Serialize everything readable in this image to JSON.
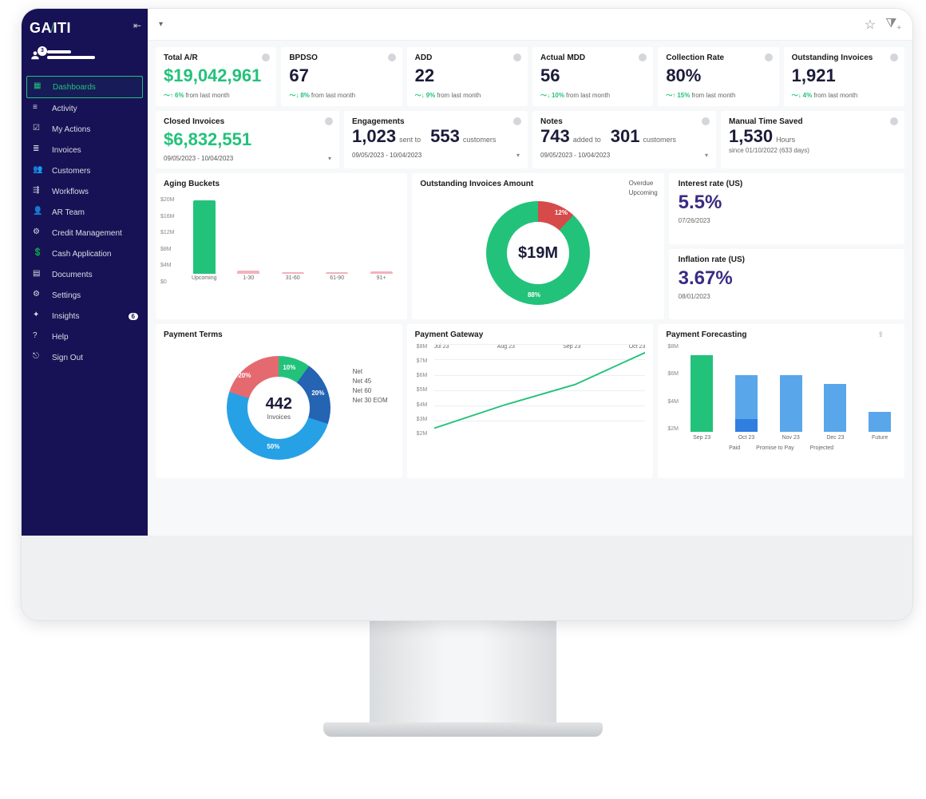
{
  "app": {
    "logo_left": "GA",
    "logo_right": "ITI"
  },
  "user": {
    "badge": "3"
  },
  "sidebar": {
    "items": [
      {
        "label": "Dashboards",
        "active": true
      },
      {
        "label": "Activity"
      },
      {
        "label": "My Actions"
      },
      {
        "label": "Invoices"
      },
      {
        "label": "Customers"
      },
      {
        "label": "Workflows"
      },
      {
        "label": "AR Team"
      },
      {
        "label": "Credit Management"
      },
      {
        "label": "Cash Application"
      },
      {
        "label": "Documents"
      },
      {
        "label": "Settings"
      },
      {
        "label": "Insights",
        "badge": "6"
      },
      {
        "label": "Help"
      },
      {
        "label": "Sign Out"
      }
    ]
  },
  "kpis": [
    {
      "title": "Total A/R",
      "value": "$19,042,961",
      "color": "green",
      "trend": "up",
      "delta": "6%",
      "sub": "from last month"
    },
    {
      "title": "BPDSO",
      "value": "67",
      "color": "dark",
      "trend": "downgreen",
      "delta": "8%",
      "sub": "from last month"
    },
    {
      "title": "ADD",
      "value": "22",
      "color": "dark",
      "trend": "downgreen",
      "delta": "9%",
      "sub": "from last month"
    },
    {
      "title": "Actual MDD",
      "value": "56",
      "color": "dark",
      "trend": "downgreen",
      "delta": "10%",
      "sub": "from last month"
    },
    {
      "title": "Collection Rate",
      "value": "80%",
      "color": "dark",
      "trend": "up",
      "delta": "15%",
      "sub": "from last month"
    },
    {
      "title": "Outstanding Invoices",
      "value": "1,921",
      "color": "dark",
      "trend": "downgreen",
      "delta": "4%",
      "sub": "from last month"
    }
  ],
  "row2": {
    "closed": {
      "title": "Closed Invoices",
      "value": "$6,832,551",
      "date": "09/05/2023 - 10/04/2023"
    },
    "engagements": {
      "title": "Engagements",
      "v1": "1,023",
      "l1": "sent to",
      "v2": "553",
      "l2": "customers",
      "date": "09/05/2023 - 10/04/2023"
    },
    "notes": {
      "title": "Notes",
      "v1": "743",
      "l1": "added to",
      "v2": "301",
      "l2": "customers",
      "date": "09/05/2023 - 10/04/2023"
    },
    "timesaved": {
      "title": "Manual Time Saved",
      "value": "1,530",
      "unit": "Hours",
      "sub": "since 01/10/2022 (633 days)"
    }
  },
  "aging": {
    "title": "Aging Buckets",
    "yticks": [
      "$20M",
      "$16M",
      "$12M",
      "$8M",
      "$4M",
      "$0"
    ],
    "bars": [
      {
        "label": "Upcoming",
        "value": 16.8,
        "color": "#22c27a"
      },
      {
        "label": "1-30",
        "value": 0.7,
        "color": "#f1b2bc"
      },
      {
        "label": "31-60",
        "value": 0.4,
        "color": "#f1b2bc"
      },
      {
        "label": "61-90",
        "value": 0.4,
        "color": "#f1b2bc"
      },
      {
        "label": "91+",
        "value": 0.6,
        "color": "#f1b2bc"
      }
    ]
  },
  "outstanding_donut": {
    "title": "Outstanding Invoices Amount",
    "center": "$19M",
    "slices": [
      {
        "label": "12%",
        "name": "Overdue"
      },
      {
        "label": "88%",
        "name": "Upcoming"
      }
    ],
    "legend": [
      "Overdue",
      "Upcoming"
    ]
  },
  "rates": {
    "interest": {
      "title": "Interest rate (US)",
      "value": "5.5%",
      "date": "07/26/2023"
    },
    "inflation": {
      "title": "Inflation rate (US)",
      "value": "3.67%",
      "date": "08/01/2023"
    }
  },
  "payment_terms": {
    "title": "Payment Terms",
    "center": "442",
    "center_sub": "Invoices",
    "slices": [
      {
        "pct": "10%",
        "name": "Net"
      },
      {
        "pct": "20%",
        "name": "Net 45"
      },
      {
        "pct": "50%",
        "name": "Net 60"
      },
      {
        "pct": "20%",
        "name": "Net 30 EOM"
      }
    ]
  },
  "gateway": {
    "title": "Payment Gateway",
    "yticks": [
      "$8M",
      "$7M",
      "$6M",
      "$5M",
      "$4M",
      "$3M",
      "$2M"
    ],
    "x": [
      "Jul 23",
      "Aug 23",
      "Sep 23",
      "Oct 23"
    ],
    "values": [
      2.4,
      4.0,
      5.4,
      7.6
    ]
  },
  "forecast": {
    "title": "Payment Forecasting",
    "yticks": [
      "$8M",
      "$6M",
      "$4M",
      "$2M"
    ],
    "cols": [
      {
        "x": "Sep 23",
        "paid": 7.0,
        "promise": 0,
        "proj": 0
      },
      {
        "x": "Oct 23",
        "paid": 0,
        "promise": 1.2,
        "proj": 4.0
      },
      {
        "x": "Nov 23",
        "paid": 0,
        "promise": 0,
        "proj": 5.2
      },
      {
        "x": "Dec 23",
        "paid": 0,
        "promise": 0,
        "proj": 4.4
      },
      {
        "x": "Future",
        "paid": 0,
        "promise": 0,
        "proj": 1.8
      }
    ],
    "legend": [
      "Paid",
      "Promise to Pay",
      "Projected"
    ]
  },
  "chart_data": [
    {
      "type": "bar",
      "title": "Aging Buckets",
      "ylabel": "$",
      "ylim": [
        0,
        20
      ],
      "categories": [
        "Upcoming",
        "1-30",
        "31-60",
        "61-90",
        "91+"
      ],
      "values": [
        16.8,
        0.7,
        0.4,
        0.4,
        0.6
      ]
    },
    {
      "type": "pie",
      "title": "Outstanding Invoices Amount",
      "series": [
        {
          "name": "Overdue",
          "value": 12
        },
        {
          "name": "Upcoming",
          "value": 88
        }
      ],
      "center_total": "$19M"
    },
    {
      "type": "pie",
      "title": "Payment Terms",
      "center_total": 442,
      "series": [
        {
          "name": "Net",
          "value": 10
        },
        {
          "name": "Net 45",
          "value": 20
        },
        {
          "name": "Net 60",
          "value": 50
        },
        {
          "name": "Net 30 EOM",
          "value": 20
        }
      ]
    },
    {
      "type": "line",
      "title": "Payment Gateway",
      "xlabel": "",
      "ylabel": "$",
      "ylim": [
        2,
        8
      ],
      "x": [
        "Jul 23",
        "Aug 23",
        "Sep 23",
        "Oct 23"
      ],
      "values": [
        2.4,
        4.0,
        5.4,
        7.6
      ]
    },
    {
      "type": "bar",
      "title": "Payment Forecasting",
      "ylabel": "$M",
      "ylim": [
        0,
        8
      ],
      "categories": [
        "Sep 23",
        "Oct 23",
        "Nov 23",
        "Dec 23",
        "Future"
      ],
      "series": [
        {
          "name": "Paid",
          "values": [
            7.0,
            0,
            0,
            0,
            0
          ]
        },
        {
          "name": "Promise to Pay",
          "values": [
            0,
            1.2,
            0,
            0,
            0
          ]
        },
        {
          "name": "Projected",
          "values": [
            0,
            4.0,
            5.2,
            4.4,
            1.8
          ]
        }
      ]
    }
  ]
}
